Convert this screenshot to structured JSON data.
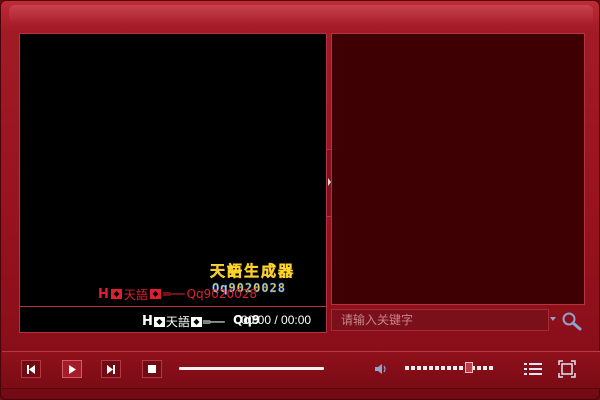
{
  "video": {
    "watermark_mark": "天語",
    "watermark_text": "Qq9020028",
    "logo_title": "天語生成器",
    "logo_digits": "Qq9020028"
  },
  "status_bar": {
    "mark_text": "天語",
    "qq_label": "Qq9",
    "time": "00:00 / 00:00"
  },
  "search": {
    "placeholder": "请输入关键字"
  },
  "controls": {
    "prev_icon": "skip-previous-icon",
    "play_icon": "play-icon",
    "next_icon": "skip-next-icon",
    "stop_icon": "stop-icon",
    "progress_fraction": 1.0,
    "volume_fraction": 0.73,
    "volume_icon": "speaker-icon",
    "playlist_icon": "list-icon",
    "fullscreen_icon": "fullscreen-icon"
  },
  "colors": {
    "frame": "#a11b27",
    "playlist_bg": "#3e0003",
    "accent_red": "#e02030",
    "logo_blue": "#1a6bff",
    "logo_yellow": "#ffd42a"
  }
}
